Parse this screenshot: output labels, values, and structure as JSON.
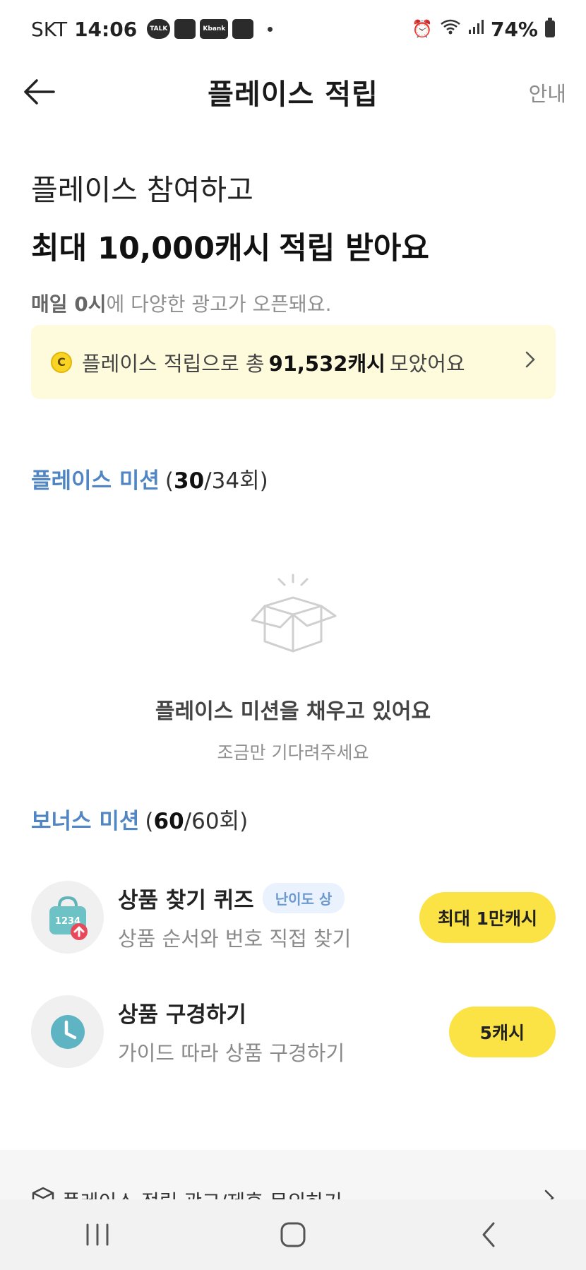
{
  "status_bar": {
    "carrier": "SKT",
    "time": "14:06",
    "notif_talk": "TALK",
    "notif_kbank": "Kbank",
    "battery": "74%"
  },
  "header": {
    "title": "플레이스 적립",
    "guide": "안내"
  },
  "hero": {
    "line1": "플레이스 참여하고",
    "highlight": "최대 10,000캐시",
    "line2_rest": "적립 받아요",
    "sub_bold": "매일 0시",
    "sub_rest": "에 다양한 광고가 오픈돼요."
  },
  "total": {
    "coin": "C",
    "prefix": "플레이스 적립으로 총",
    "amount": "91,532캐시",
    "suffix": "모았어요"
  },
  "place_mission": {
    "name": "플레이스 미션",
    "open": "(",
    "done": "30",
    "rest": "/34회)"
  },
  "empty_state": {
    "title": "플레이스 미션을 채우고 있어요",
    "subtitle": "조금만 기다려주세요"
  },
  "bonus_mission": {
    "name": "보너스 미션",
    "open": "(",
    "done": "60",
    "rest": "/60회)"
  },
  "missions": [
    {
      "icon": "shopping-bag-icon",
      "icon_text": "1234",
      "title": "상품 찾기 퀴즈",
      "tag": "난이도 상",
      "desc": "상품 순서와 번호 직접 찾기",
      "reward": "최대 1만캐시"
    },
    {
      "icon": "clock-icon",
      "title": "상품 구경하기",
      "desc": "가이드 따라 상품 구경하기",
      "reward": "5캐시"
    }
  ],
  "inquiry": {
    "label": "플레이스 적립 광고/제휴 문의하기"
  },
  "colors": {
    "accent_blue": "#4f86c3",
    "highlight_yellow": "#fde848",
    "button_yellow": "#fbe245",
    "info_box": "#fefbdc"
  }
}
